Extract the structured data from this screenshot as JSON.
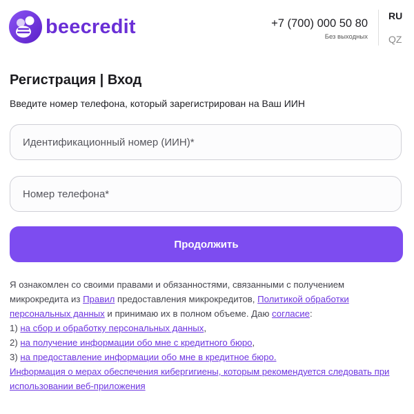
{
  "header": {
    "logo_text": "beecredit",
    "phone": "+7 (700) 000 50 80",
    "hours": "Без выходных",
    "lang_active": "RU",
    "lang_alt": "QZ"
  },
  "form": {
    "title": "Регистрация | Вход",
    "subtitle": "Введите номер телефона, который зарегистрирован на Ваш ИИН",
    "iin_placeholder": "Идентификационный номер (ИИН)*",
    "phone_placeholder": "Номер телефона*",
    "continue_label": "Продолжить"
  },
  "legal": {
    "t1": "Я ознакомлен со своими правами и обязанностями, связанными с получением микрокредита из ",
    "l_rules": "Правил",
    "t2": " предоставления микрокредитов, ",
    "l_policy": "Политикой обработки персональных данных",
    "t3": " и принимаю их в полном объеме. Даю ",
    "l_consent": "согласие",
    "t4": ":",
    "n1": "1) ",
    "l_item1": "на сбор и обработку персональных данных",
    "t5": ",",
    "n2": "2) ",
    "l_item2": "на получение информации обо мне с кредитного бюро",
    "t6": ",",
    "n3": "3) ",
    "l_item3": "на предоставление информации обо мне в кредитное бюро.",
    "l_cyber": "Информация о мерах обеспечения кибергигиены, которым рекомендуется следовать при использовании веб-приложения"
  },
  "colors": {
    "brand": "#6a2fd6",
    "button": "#7d4cf0",
    "link": "#6d35e0"
  },
  "icons": {
    "logo": "bee-icon"
  }
}
